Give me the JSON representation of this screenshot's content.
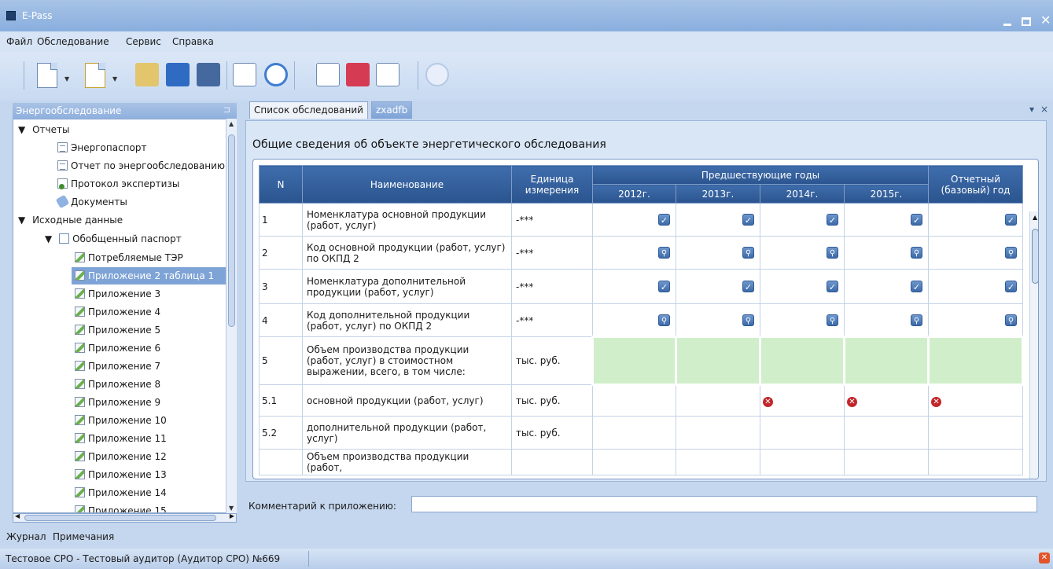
{
  "window": {
    "title": "E-Pass"
  },
  "menu": [
    "Файл",
    "Обследование",
    "Сервис",
    "Справка"
  ],
  "toolbar_icons": [
    "new-document-icon",
    "new-file-icon",
    "open-folder-icon",
    "save-icon",
    "save-all-icon",
    "checklist-icon",
    "refresh-icon",
    "report-icon",
    "xml-export-icon",
    "table-edit-icon",
    "help-icon"
  ],
  "left_panel": {
    "title": "Энергообследование",
    "pin": "⊐",
    "tree": [
      {
        "label": "Отчеты",
        "level": 0,
        "expander": "▼"
      },
      {
        "label": "Энергопаспорт",
        "level": 1,
        "icon": "page"
      },
      {
        "label": "Отчет по энергообследованию",
        "level": 1,
        "icon": "page"
      },
      {
        "label": "Протокол экспертизы",
        "level": 1,
        "icon": "ok"
      },
      {
        "label": "Документы",
        "level": 1,
        "icon": "doc"
      },
      {
        "label": "Исходные данные",
        "level": 0,
        "expander": "▼"
      },
      {
        "label": "Обобщенный паспорт",
        "level": 1,
        "icon": "pages",
        "expander": "▼"
      },
      {
        "label": "Потребляемые ТЭР",
        "level": 2,
        "icon": "edit"
      },
      {
        "label": "Приложение 2 таблица 1",
        "level": 2,
        "icon": "edit",
        "selected": true
      },
      {
        "label": "Приложение 3",
        "level": 2,
        "icon": "edit"
      },
      {
        "label": "Приложение 4",
        "level": 2,
        "icon": "edit"
      },
      {
        "label": "Приложение 5",
        "level": 2,
        "icon": "edit"
      },
      {
        "label": "Приложение 6",
        "level": 2,
        "icon": "edit"
      },
      {
        "label": "Приложение 7",
        "level": 2,
        "icon": "edit"
      },
      {
        "label": "Приложение 8",
        "level": 2,
        "icon": "edit"
      },
      {
        "label": "Приложение 9",
        "level": 2,
        "icon": "edit"
      },
      {
        "label": "Приложение 10",
        "level": 2,
        "icon": "edit"
      },
      {
        "label": "Приложение 11",
        "level": 2,
        "icon": "edit"
      },
      {
        "label": "Приложение 12",
        "level": 2,
        "icon": "edit"
      },
      {
        "label": "Приложение 13",
        "level": 2,
        "icon": "edit"
      },
      {
        "label": "Приложение 14",
        "level": 2,
        "icon": "edit"
      },
      {
        "label": "Приложение 15",
        "level": 2,
        "icon": "edit"
      }
    ]
  },
  "tabs": [
    {
      "label": "Список обследований",
      "active": false
    },
    {
      "label": "zxadfb",
      "active": true
    }
  ],
  "tab_controls": {
    "dropdown": "▾",
    "close": "×"
  },
  "main": {
    "heading": "Общие сведения об объекте энергетического обследования",
    "columns": {
      "n": "N",
      "name": "Наименование",
      "unit_line1": "Единица",
      "unit_line2": "измерения",
      "prev_years": "Предшествующие годы",
      "years": [
        "2012г.",
        "2013г.",
        "2014г.",
        "2015г."
      ],
      "base_line1": "Отчетный",
      "base_line2": "(базовый) год"
    },
    "rows": [
      {
        "n": "1",
        "name": "Номенклатура основной продукции (работ, услуг)",
        "unit": "-***",
        "cell": "check"
      },
      {
        "n": "2",
        "name": "Код основной продукции (работ, услуг) по ОКПД 2",
        "unit": "-***",
        "cell": "search"
      },
      {
        "n": "3",
        "name": "Номенклатура дополнительной продукции (работ, услуг)",
        "unit": "-***",
        "cell": "check"
      },
      {
        "n": "4",
        "name": "Код дополнительной продукции (работ, услуг) по ОКПД 2",
        "unit": "-***",
        "cell": "search"
      },
      {
        "n": "5",
        "name": "Объем производства продукции (работ, услуг) в стоимостном выражении, всего, в том числе:",
        "unit": "тыс. руб.",
        "cell": "green"
      },
      {
        "n": "5.1",
        "name": "основной продукции (работ, услуг)",
        "unit": "тыс. руб.",
        "cell": "error"
      },
      {
        "n": "5.2",
        "name": "дополнительной продукции (работ, услуг)",
        "unit": "тыс. руб.",
        "cell": "empty"
      },
      {
        "n": "",
        "name": "Объем производства продукции (работ,",
        "unit": "",
        "cell": "empty"
      }
    ],
    "comment_label": "Комментарий к приложению:",
    "comment_value": ""
  },
  "bottom_tabs": [
    "Журнал",
    "Примечания"
  ],
  "status": {
    "text": "Тестовое СРО - Тестовый аудитор (Аудитор СРО) №669"
  }
}
